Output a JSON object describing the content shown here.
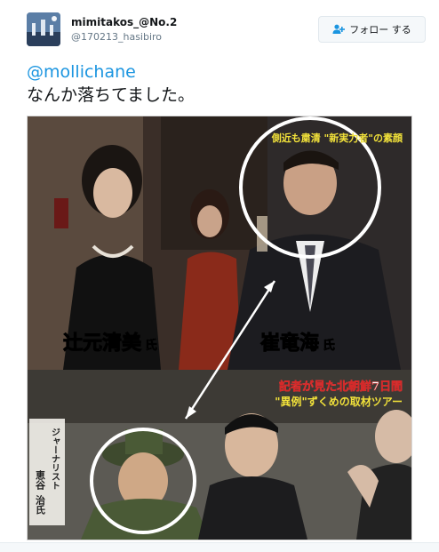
{
  "tweet": {
    "author": {
      "display_name": "mimitakos_@No.2",
      "handle": "@170213_hasibiro"
    },
    "follow_button": {
      "label": "フォロー する",
      "icon": "add-user-icon"
    },
    "mention": "@mollichane",
    "text": "なんか落ちてました。"
  },
  "media": {
    "top_caption_right": "側近も粛清 \"新実力者\"の素顔",
    "left_person_name": "辻元清美",
    "left_person_suffix": "氏",
    "right_person_name": "崔竜海",
    "right_person_suffix": "氏",
    "bottom_caption_line1": "記者が見た北朝鮮7日間",
    "bottom_caption_line2": "\"異例\"ずくめの取材ツアー",
    "vertical_label": "ジャーナリスト",
    "vertical_name_1": "恵谷",
    "vertical_name_2": "治氏"
  },
  "colors": {
    "accent": "#1b95e0",
    "caption_yellow": "#f2e23a",
    "caption_white": "#ffffff",
    "caption_red": "#d42a2a"
  }
}
